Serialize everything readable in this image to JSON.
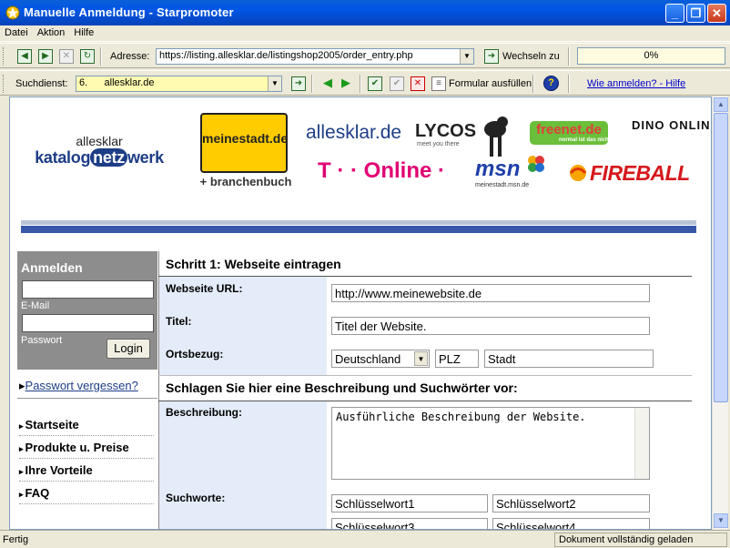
{
  "window": {
    "title": "Manuelle Anmeldung - Starpromoter",
    "min": "_",
    "max": "❐",
    "close": "✕"
  },
  "menu": [
    "Datei",
    "Aktion",
    "Hilfe"
  ],
  "toolbar": {
    "address_label": "Adresse:",
    "address_value": "https://listing.allesklar.de/listingshop2005/order_entry.php",
    "switch_label": "Wechseln zu",
    "progress": "0%",
    "search_label": "Suchdienst:",
    "search_value": "6.      allesklar.de",
    "fill_form_label": "Formular ausfüllen",
    "help_link": "Wie anmelden? - Hilfe"
  },
  "brand_logos": {
    "katalog_top": "allesklar",
    "katalog_main_a": "katalog",
    "katalog_main_n": "netz",
    "katalog_main_b": "werk",
    "meinestadt": "meinestadt.de",
    "branchenbuch": "+ branchenbuch",
    "allesklar": "allesklar.de",
    "lycos": "LYCOS",
    "lycos_tag": "meet you there",
    "freenet": "freenet.de",
    "freenet_tag": "normal ist das nicht!",
    "dino": "DINO ONLINE",
    "tonline": "T · · Online ·",
    "msn": "msn",
    "msn_tag": "meinestadt.msn.de",
    "fireball": "FIREBALL"
  },
  "login": {
    "title": "Anmelden",
    "email_label": "E-Mail",
    "password_label": "Passwort",
    "button": "Login",
    "forgot": "Passwort vergessen?"
  },
  "nav": [
    "Startseite",
    "Produkte u. Preise",
    "Ihre Vorteile",
    "FAQ"
  ],
  "form": {
    "step1": "Schritt 1: Webseite eintragen",
    "url_label": "Webseite URL:",
    "url_value": "http://www.meinewebsite.de",
    "title_label": "Titel:",
    "title_value": "Titel der Website.",
    "location_label": "Ortsbezug:",
    "country": "Deutschland",
    "plz": "PLZ",
    "city": "Stadt",
    "step2": "Schlagen Sie hier eine Beschreibung und Suchwörter vor:",
    "desc_label": "Beschreibung:",
    "desc_value": "Ausführliche Beschreibung der Website.",
    "keywords_label": "Suchworte:",
    "keywords": [
      "Schlüsselwort1",
      "Schlüsselwort2",
      "Schlüsselwort3",
      "Schlüsselwort4"
    ]
  },
  "status": {
    "left": "Fertig",
    "right": "Dokument vollständig geladen"
  }
}
